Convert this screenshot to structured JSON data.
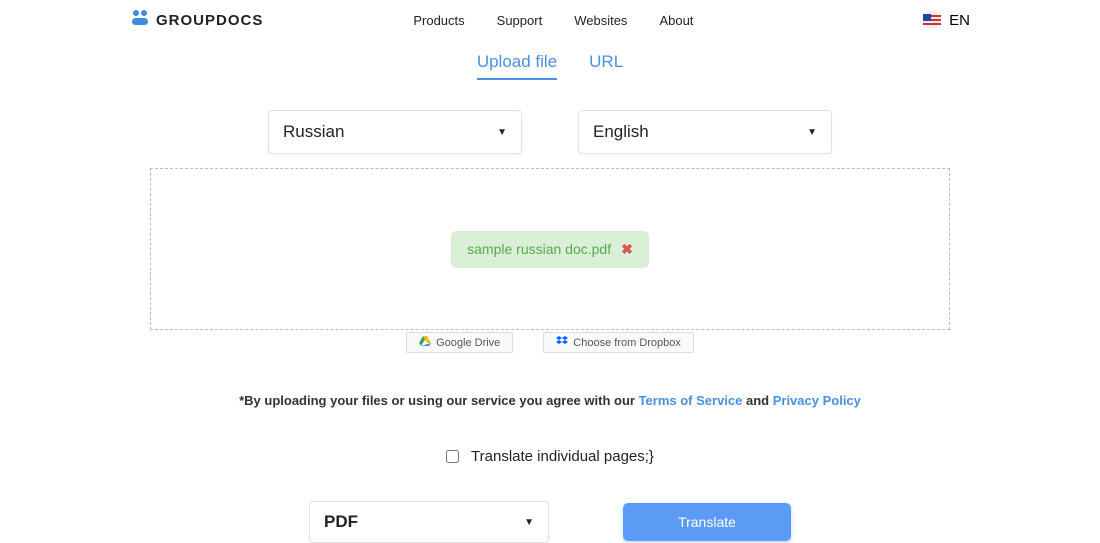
{
  "header": {
    "brand": "GROUPDOCS",
    "lang": "EN"
  },
  "nav": {
    "products": "Products",
    "support": "Support",
    "websites": "Websites",
    "about": "About"
  },
  "tabs": {
    "upload": "Upload file",
    "url": "URL"
  },
  "languages": {
    "source": "Russian",
    "target": "English"
  },
  "file": {
    "name": "sample russian doc.pdf"
  },
  "cloud": {
    "gdrive": "Google Drive",
    "dropbox": "Choose from Dropbox"
  },
  "terms": {
    "prefix": "*By uploading your files or using our service you agree with our ",
    "tos": "Terms of Service",
    "and": " and ",
    "privacy": "Privacy Policy"
  },
  "checkbox": {
    "label": "Translate individual pages;}"
  },
  "format": {
    "selected": "PDF"
  },
  "actions": {
    "translate": "Translate"
  }
}
